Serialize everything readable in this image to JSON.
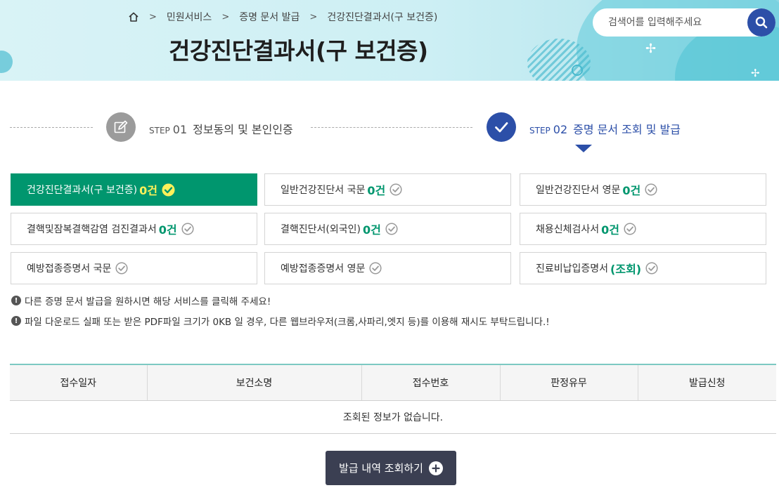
{
  "breadcrumb": {
    "items": [
      "민원서비스",
      "증명 문서 발급",
      "건강진단결과서(구 보건증)"
    ]
  },
  "page_title": "건강진단결과서(구 보건증)",
  "search": {
    "placeholder": "검색어를 입력해주세요"
  },
  "steps": [
    {
      "tag": "STEP",
      "num": "01",
      "label": "정보동의 및 본인인증",
      "icon": "pencil-icon",
      "state": "done"
    },
    {
      "tag": "STEP",
      "num": "02",
      "label": "증명 문서 조회 및 발급",
      "icon": "check-icon",
      "state": "current"
    }
  ],
  "services": [
    {
      "label": "건강진단결과서(구 보건증)",
      "count": "0건",
      "active": true
    },
    {
      "label": "일반건강진단서 국문",
      "count": "0건"
    },
    {
      "label": "일반건강진단서 영문",
      "count": "0건"
    },
    {
      "label": "결핵및잠복결핵감염 검진결과서",
      "count": "0건"
    },
    {
      "label": "결핵진단서(외국인)",
      "count": "0건"
    },
    {
      "label": "채용신체검사서",
      "count": "0건"
    },
    {
      "label": "예방접종증명서 국문",
      "count": ""
    },
    {
      "label": "예방접종증명서 영문",
      "count": ""
    },
    {
      "label": "진료비납입증명서",
      "count": "(조회)"
    }
  ],
  "notices": [
    "다른 증명 문서 발급을 원하시면 해당 서비스를 클릭해 주세요!",
    "파일 다운로드 실패 또는 받은 PDF파일 크기가 0KB 일 경우, 다른 웹브라우저(크롬,사파리,엣지 등)를 이용해 재시도 부탁드립니다.!"
  ],
  "table": {
    "columns": [
      "접수일자",
      "보건소명",
      "접수번호",
      "판정유무",
      "발급신청"
    ],
    "empty_message": "조회된 정보가 없습니다."
  },
  "issue_button_label": "발급 내역 조회하기",
  "colors": {
    "accent_green": "#00966e",
    "accent_blue": "#2c4fa8",
    "count_highlight": "#fff15a",
    "button_dark": "#3b3f52",
    "table_top_border": "#7cc9c2"
  }
}
